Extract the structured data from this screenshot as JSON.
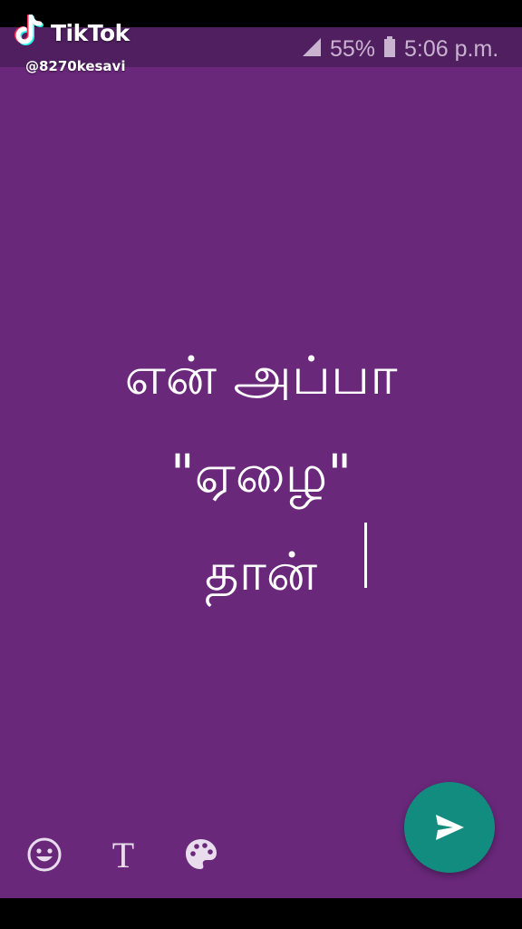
{
  "watermark": {
    "brand": "TikTok",
    "handle": "@8270kesavi",
    "logo_icon": "tiktok-note-icon"
  },
  "status_bar": {
    "signal_icon": "signal-icon",
    "battery_percent": "55%",
    "battery_icon": "battery-icon",
    "time": "5:06 p.m."
  },
  "message": {
    "lines": [
      "என் அப்பா",
      "\"ஏழை\"",
      "தான்"
    ]
  },
  "toolbar": {
    "emoji_icon": "emoji-icon",
    "font_glyph": "T",
    "palette_icon": "palette-icon",
    "send_icon": "send-icon"
  },
  "colors": {
    "background": "#6a287b",
    "status_bar": "#4f1f60",
    "send_button": "#128c7e",
    "text": "#ffffff"
  }
}
